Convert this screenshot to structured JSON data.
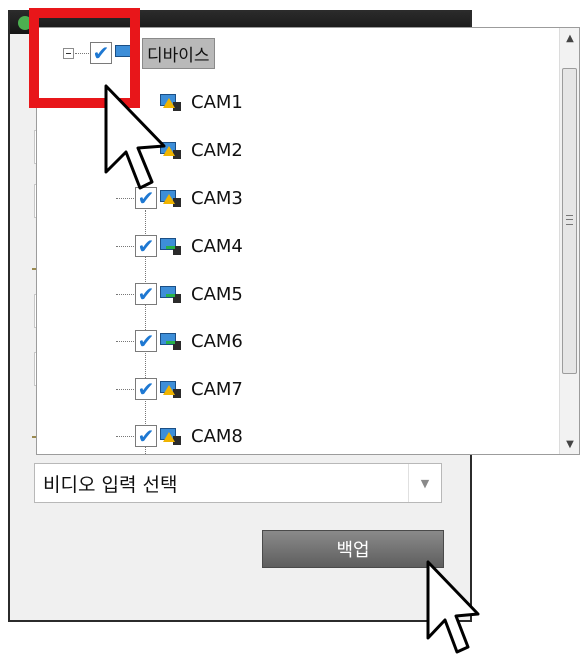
{
  "tree": {
    "root": {
      "label": "디바이스",
      "checked": true,
      "expanded": true
    },
    "items": [
      {
        "label": "CAM1",
        "checked": true,
        "status": "warning"
      },
      {
        "label": "CAM2",
        "checked": true,
        "status": "warning"
      },
      {
        "label": "CAM3",
        "checked": true,
        "status": "warning"
      },
      {
        "label": "CAM4",
        "checked": true,
        "status": "ok"
      },
      {
        "label": "CAM5",
        "checked": true,
        "status": "ok"
      },
      {
        "label": "CAM6",
        "checked": true,
        "status": "ok"
      },
      {
        "label": "CAM7",
        "checked": true,
        "status": "warning"
      },
      {
        "label": "CAM8",
        "checked": true,
        "status": "warning"
      }
    ]
  },
  "video_select": {
    "value": "비디오 입력 선택"
  },
  "backup_button": {
    "label": "백업"
  },
  "icons": {
    "check": "✔",
    "scroll_up": "▲",
    "scroll_down": "▼",
    "dropdown": "▼"
  },
  "colors": {
    "highlight": "#e8161a",
    "checkmark": "#1e78d2",
    "warning": "#f0b400",
    "ok": "#27b24a"
  }
}
